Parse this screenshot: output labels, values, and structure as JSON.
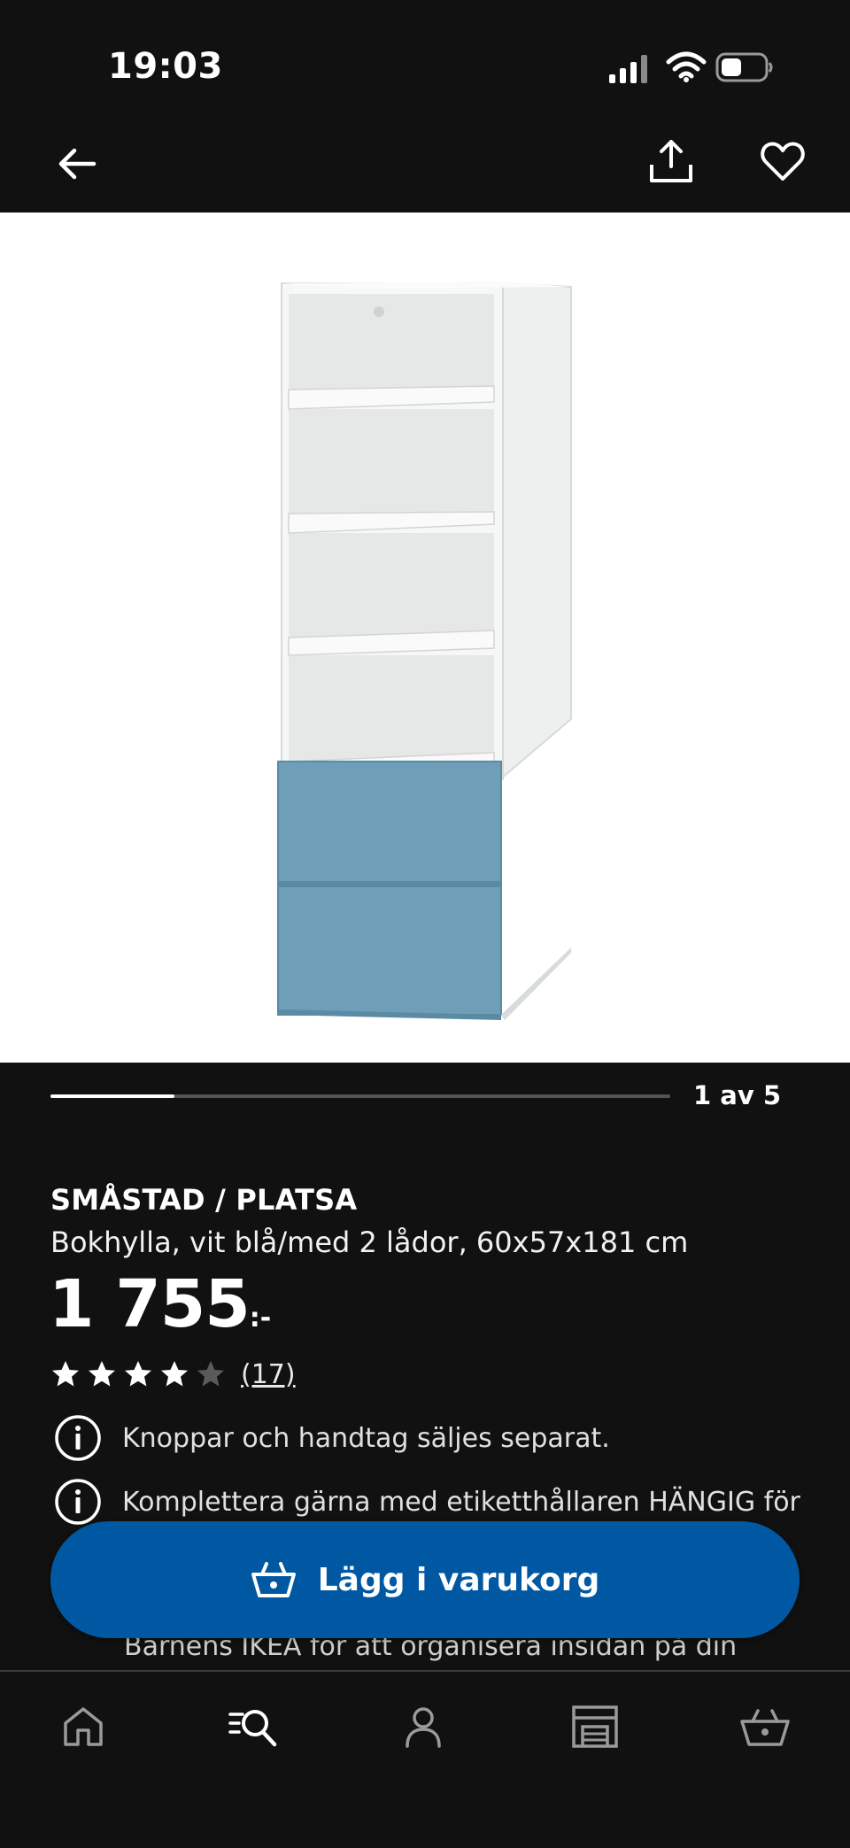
{
  "status_bar": {
    "time": "19:03"
  },
  "nav": {
    "back_icon": "arrow-left-icon",
    "share_icon": "share-icon",
    "favorite_icon": "heart-icon"
  },
  "carousel": {
    "counter": "1 av 5",
    "progress": 0.2
  },
  "product": {
    "name": "SMÅSTAD / PLATSA",
    "description": "Bokhylla, vit blå/med 2 lådor, 60x57x181 cm",
    "price": "1 755",
    "price_suffix": ":-",
    "rating": 4,
    "rating_max": 5,
    "review_count": "(17)"
  },
  "info_items": [
    {
      "icon": "info-icon",
      "text": "Knoppar och handtag säljes separat."
    },
    {
      "icon": "info-icon",
      "text": "Komplettera gärna med etiketthållaren HÄNGIG för"
    }
  ],
  "info_continuation": "Barnens IKEA för att organisera insidan på din",
  "cart_button": {
    "icon": "basket-icon",
    "label": "Lägg i varukorg"
  },
  "tab_bar": {
    "items": [
      {
        "icon": "home-icon"
      },
      {
        "icon": "search-menu-icon"
      },
      {
        "icon": "profile-icon"
      },
      {
        "icon": "store-icon"
      },
      {
        "icon": "basket-icon"
      }
    ]
  },
  "colors": {
    "background": "#111111",
    "accent": "#0058a3",
    "drawer_blue": "#6f9fb8",
    "cabinet_white": "#f4f5f5"
  }
}
